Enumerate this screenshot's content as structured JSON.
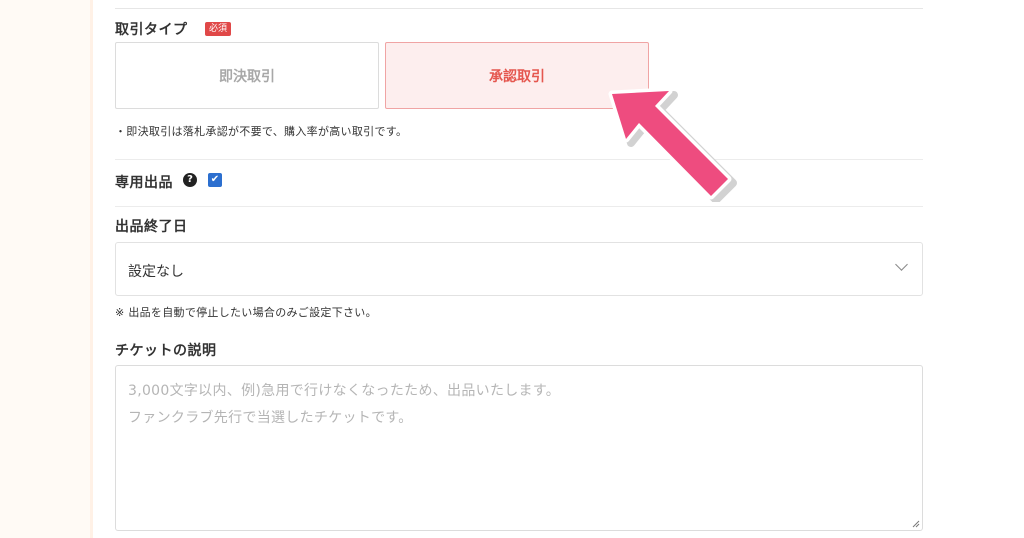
{
  "transaction_type": {
    "label": "取引タイプ",
    "required_badge": "必須",
    "options": [
      {
        "label": "即決取引",
        "selected": false
      },
      {
        "label": "承認取引",
        "selected": true
      }
    ],
    "note": "・即決取引は落札承認が不要で、購入率が高い取引です。"
  },
  "exclusive_listing": {
    "label": "専用出品",
    "help_icon": "question-circle-icon",
    "checked": true
  },
  "end_date": {
    "label": "出品終了日",
    "value": "設定なし",
    "note": "※ 出品を自動で停止したい場合のみご設定下さい。"
  },
  "description": {
    "label": "チケットの説明",
    "placeholder_line1": "3,000文字以内、例)急用で行けなくなったため、出品いたします。",
    "placeholder_line2": "ファンクラブ先行で当選したチケットです。"
  },
  "colors": {
    "required": "#e04848",
    "selected_option_bg": "#fdeeee",
    "selected_option_text": "#e5574f",
    "checkbox": "#2c6fcf",
    "annotation_arrow": "#ee4c7f"
  }
}
